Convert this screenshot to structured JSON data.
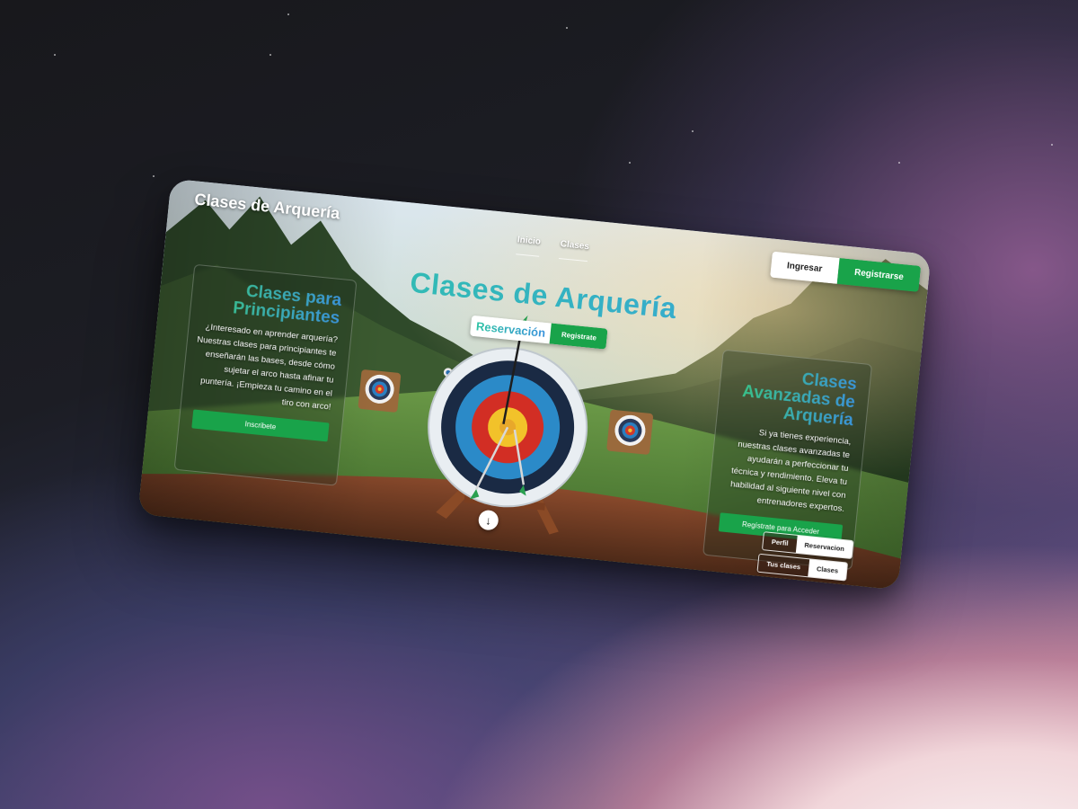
{
  "brand": {
    "title": "Clases de Arquería"
  },
  "nav": {
    "items": [
      {
        "label": "Inicio"
      },
      {
        "label": "Clases"
      }
    ]
  },
  "auth": {
    "login_label": "Ingresar",
    "register_label": "Registrarse"
  },
  "hero": {
    "title": "Clases de Arquería",
    "reservation_label": "Reservación",
    "register_label": "Registrate"
  },
  "beginners": {
    "title": "Clases para Principiantes",
    "description": "¿Interesado en aprender arquería? Nuestras clases para principiantes te enseñarán las bases, desde cómo sujetar el arco hasta afinar tu puntería. ¡Empieza tu camino en el tiro con arco!",
    "cta_label": "Inscribete"
  },
  "advanced": {
    "title": "Clases Avanzadas de Arquería",
    "description": "Si ya tienes experiencia, nuestras clases avanzadas te ayudarán a perfeccionar tu técnica y rendimiento. Eleva tu habilidad al siguiente nivel con entrenadores expertos.",
    "cta_label": "Regístrate para Acceder"
  },
  "quick_links": {
    "profile_label": "Perfil",
    "reservation_label": "Reservacion",
    "my_classes_label": "Tus clases",
    "classes_label": "Clases"
  },
  "icons": {
    "scroll": "arrow-down-icon"
  },
  "colors": {
    "accent_green": "#19a34a",
    "title_gradient_start": "#2ec7a0",
    "title_gradient_end": "#3aa0e0"
  }
}
